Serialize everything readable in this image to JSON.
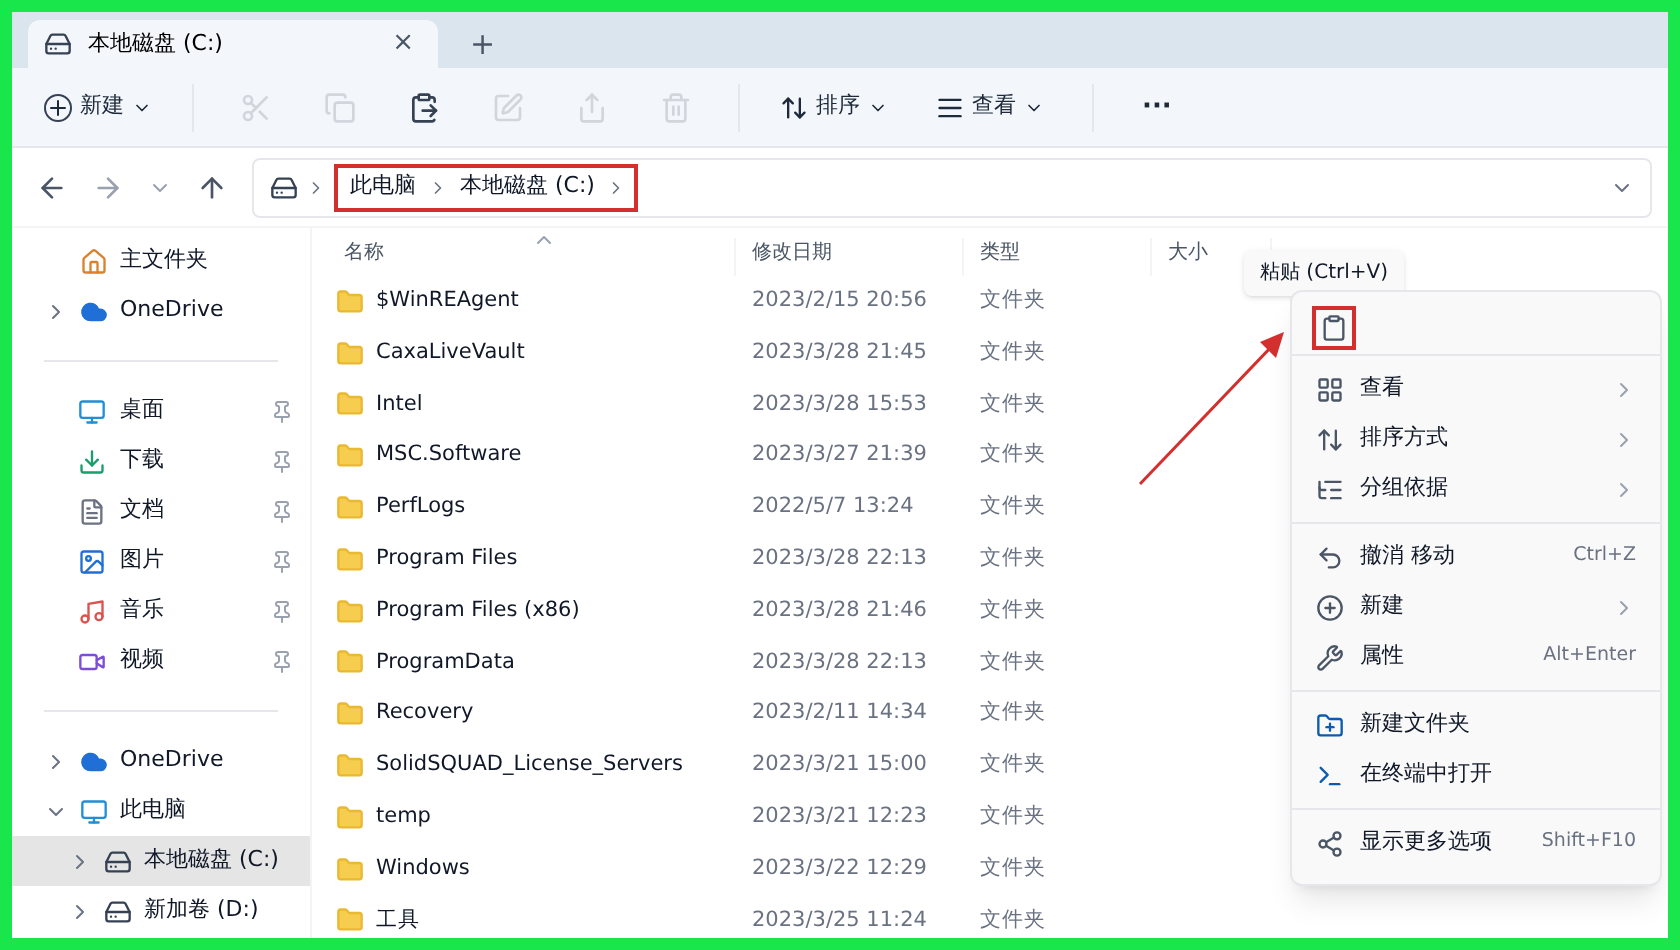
{
  "tab": {
    "title": "本地磁盘 (C:)",
    "close": "×",
    "new_tab": "+"
  },
  "toolbar": {
    "new_label": "新建",
    "actions": [
      {
        "disabled": true
      },
      {
        "disabled": true
      },
      {
        "disabled": false
      },
      {
        "disabled": true
      },
      {
        "disabled": true
      },
      {
        "disabled": true
      }
    ],
    "sort_label": "排序",
    "view_label": "查看",
    "more": "···"
  },
  "address": {
    "crumbs": [
      "此电脑",
      "本地磁盘 (C:)"
    ]
  },
  "sidebar": {
    "quick": [
      {
        "label": "主文件夹",
        "expandable": false
      },
      {
        "label": "OneDrive",
        "expandable": true
      }
    ],
    "pinned": [
      {
        "label": "桌面",
        "pinned": true
      },
      {
        "label": "下载",
        "pinned": true
      },
      {
        "label": "文档",
        "pinned": true
      },
      {
        "label": "图片",
        "pinned": true
      },
      {
        "label": "音乐",
        "pinned": true
      },
      {
        "label": "视频",
        "pinned": true
      }
    ],
    "tree": [
      {
        "label": "OneDrive",
        "expanded": false,
        "selected": false
      },
      {
        "label": "此电脑",
        "expanded": true,
        "selected": false,
        "children": [
          {
            "label": "本地磁盘 (C:)",
            "selected": true
          },
          {
            "label": "新加卷 (D:)",
            "selected": false
          }
        ]
      }
    ]
  },
  "table": {
    "columns": [
      "名称",
      "修改日期",
      "类型",
      "大小"
    ],
    "rows": [
      {
        "name": "$WinREAgent",
        "date": "2023/2/15 20:56",
        "type": "文件夹"
      },
      {
        "name": "CaxaLiveVault",
        "date": "2023/3/28 21:45",
        "type": "文件夹"
      },
      {
        "name": "Intel",
        "date": "2023/3/28 15:53",
        "type": "文件夹"
      },
      {
        "name": "MSC.Software",
        "date": "2023/3/27 21:39",
        "type": "文件夹"
      },
      {
        "name": "PerfLogs",
        "date": "2022/5/7 13:24",
        "type": "文件夹"
      },
      {
        "name": "Program Files",
        "date": "2023/3/28 22:13",
        "type": "文件夹"
      },
      {
        "name": "Program Files (x86)",
        "date": "2023/3/28 21:46",
        "type": "文件夹"
      },
      {
        "name": "ProgramData",
        "date": "2023/3/28 22:13",
        "type": "文件夹"
      },
      {
        "name": "Recovery",
        "date": "2023/2/11 14:34",
        "type": "文件夹"
      },
      {
        "name": "SolidSQUAD_License_Servers",
        "date": "2023/3/21 15:00",
        "type": "文件夹"
      },
      {
        "name": "temp",
        "date": "2023/3/21 12:23",
        "type": "文件夹"
      },
      {
        "name": "Windows",
        "date": "2023/3/22 12:29",
        "type": "文件夹"
      },
      {
        "name": "工具",
        "date": "2023/3/25 11:24",
        "type": "文件夹"
      }
    ]
  },
  "context_menu": {
    "tooltip": "粘贴 (Ctrl+V)",
    "groups": [
      [
        {
          "label": "查看",
          "submenu": true
        },
        {
          "label": "排序方式",
          "submenu": true
        },
        {
          "label": "分组依据",
          "submenu": true
        }
      ],
      [
        {
          "label": "撤消 移动",
          "shortcut": "Ctrl+Z",
          "submenu": false
        },
        {
          "label": "新建",
          "submenu": true
        },
        {
          "label": "属性",
          "shortcut": "Alt+Enter",
          "submenu": false
        }
      ],
      [
        {
          "label": "新建文件夹",
          "submenu": false
        },
        {
          "label": "在终端中打开",
          "submenu": false
        }
      ],
      [
        {
          "label": "显示更多选项",
          "shortcut": "Shift+F10",
          "submenu": false
        }
      ]
    ]
  }
}
